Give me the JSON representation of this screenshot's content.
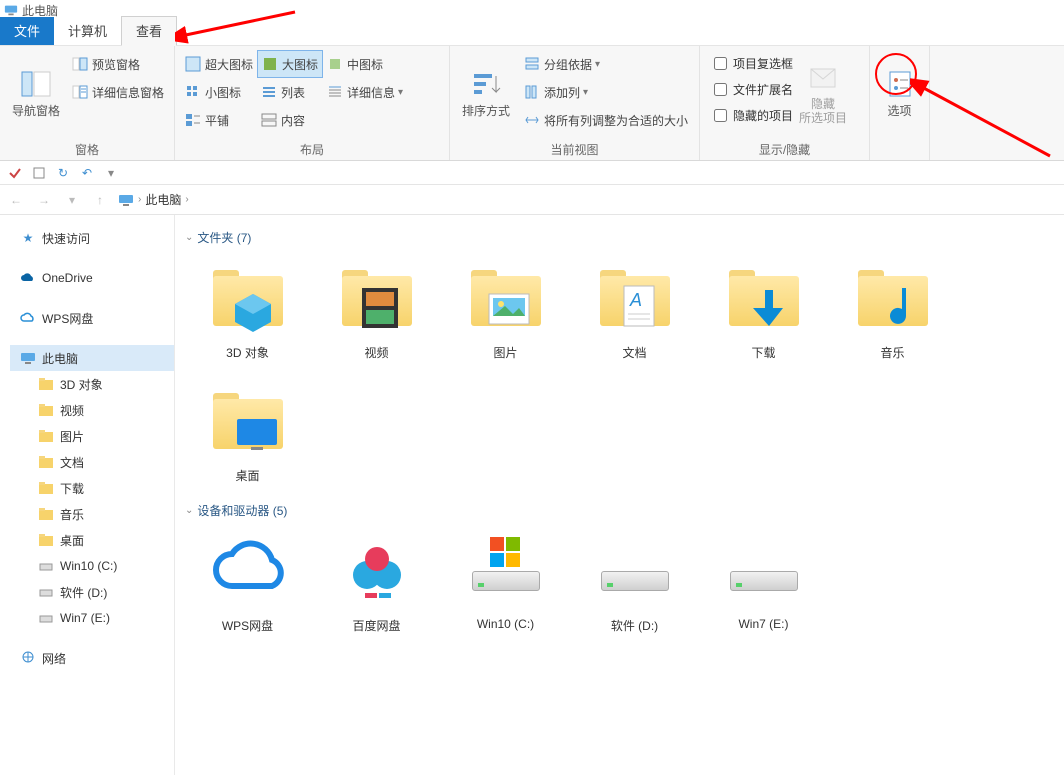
{
  "window": {
    "title": "此电脑"
  },
  "tabs": {
    "file": "文件",
    "computer": "计算机",
    "view": "查看"
  },
  "ribbon": {
    "panes": {
      "label": "窗格",
      "nav": "导航窗格",
      "preview": "预览窗格",
      "details": "详细信息窗格"
    },
    "layout": {
      "label": "布局",
      "xlarge": "超大图标",
      "large": "大图标",
      "medium": "中图标",
      "small": "小图标",
      "list": "列表",
      "details": "详细信息",
      "tiles": "平铺",
      "content": "内容"
    },
    "currentview": {
      "label": "当前视图",
      "sortby": "排序方式",
      "groupby": "分组依据",
      "addcols": "添加列",
      "sizecols": "将所有列调整为合适的大小"
    },
    "showhide": {
      "label": "显示/隐藏",
      "checkboxes": "项目复选框",
      "extensions": "文件扩展名",
      "hiddenitems": "隐藏的项目",
      "hideselected": "隐藏\n所选项目"
    },
    "options": {
      "label": "选项"
    }
  },
  "addressbar": {
    "location": "此电脑"
  },
  "sidebar": {
    "quick": "快速访问",
    "onedrive": "OneDrive",
    "wps": "WPS网盘",
    "thispc": "此电脑",
    "children": {
      "obj3d": "3D 对象",
      "videos": "视频",
      "pictures": "图片",
      "documents": "文档",
      "downloads": "下载",
      "music": "音乐",
      "desktop": "桌面",
      "c": "Win10 (C:)",
      "d": "软件 (D:)",
      "e": "Win7 (E:)"
    },
    "network": "网络"
  },
  "content": {
    "folders": {
      "header": "文件夹 (7)",
      "items": [
        {
          "label": "3D 对象"
        },
        {
          "label": "视频"
        },
        {
          "label": "图片"
        },
        {
          "label": "文档"
        },
        {
          "label": "下载"
        },
        {
          "label": "音乐"
        },
        {
          "label": "桌面"
        }
      ]
    },
    "drives": {
      "header": "设备和驱动器 (5)",
      "items": [
        {
          "label": "WPS网盘"
        },
        {
          "label": "百度网盘"
        },
        {
          "label": "Win10 (C:)"
        },
        {
          "label": "软件 (D:)"
        },
        {
          "label": "Win7 (E:)"
        }
      ]
    }
  },
  "colors": {
    "accent": "#1979ca",
    "arrow": "#ff0000",
    "folder": "#f7d36b"
  }
}
